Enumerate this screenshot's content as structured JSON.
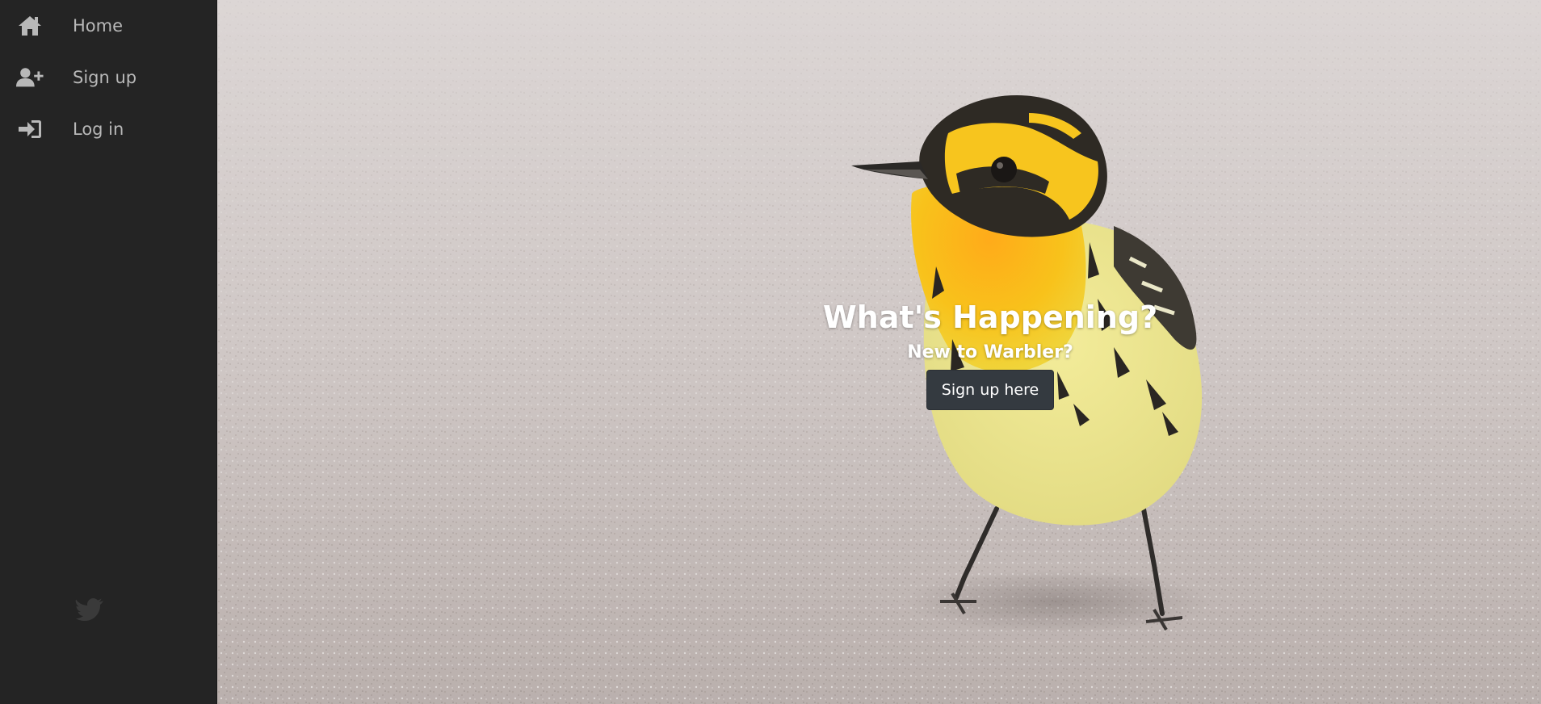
{
  "sidebar": {
    "items": [
      {
        "label": "Home",
        "icon": "home-icon"
      },
      {
        "label": "Sign up",
        "icon": "user-plus-icon"
      },
      {
        "label": "Log in",
        "icon": "sign-in-icon"
      }
    ],
    "logo_icon": "twitter-bird-icon"
  },
  "hero": {
    "title": "What's Happening?",
    "subtitle": "New to Warbler?",
    "cta_label": "Sign up here",
    "background_image": "bird-on-sand-photo"
  },
  "colors": {
    "sidebar_bg": "#242424",
    "sidebar_text": "#b8b8b8",
    "button_bg": "#343a40",
    "hero_text": "#ffffff"
  }
}
